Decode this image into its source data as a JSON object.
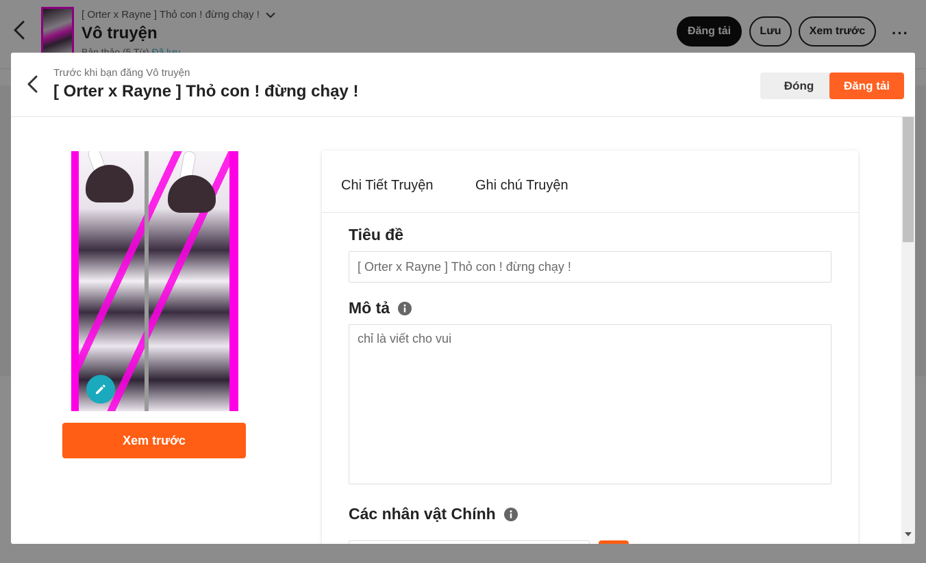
{
  "background": {
    "story_title": "[ Orter x Rayne ] Thỏ con ! đừng chạy !",
    "part_title": "Vô truyện",
    "draft_status": "Bản thảo (5 Từ)",
    "saved_status": "Đã lưu",
    "buttons": {
      "publish": "Đăng tải",
      "save": "Lưu",
      "preview": "Xem trước"
    },
    "more_icon": "more-horizontal-icon"
  },
  "modal": {
    "subtitle": "Trước khi bạn đăng Vô truyện",
    "title": "[ Orter x Rayne ] Thỏ con ! đừng chạy !",
    "close_label": "Đóng",
    "publish_label": "Đăng tải",
    "preview_label": "Xem trước",
    "tabs": [
      "Chi Tiết Truyện",
      "Ghi chú Truyện"
    ],
    "fields": {
      "title_label": "Tiêu đề",
      "title_value": "[ Orter x Rayne ] Thỏ con ! đừng chạy !",
      "description_label": "Mô tả",
      "description_value": "chỉ là viết cho vui",
      "main_characters_label": "Các nhân vật Chính"
    },
    "colors": {
      "accent": "#ff6122",
      "edit_fab": "#1aa9bd",
      "cover_frame": "#ff00e6"
    }
  }
}
